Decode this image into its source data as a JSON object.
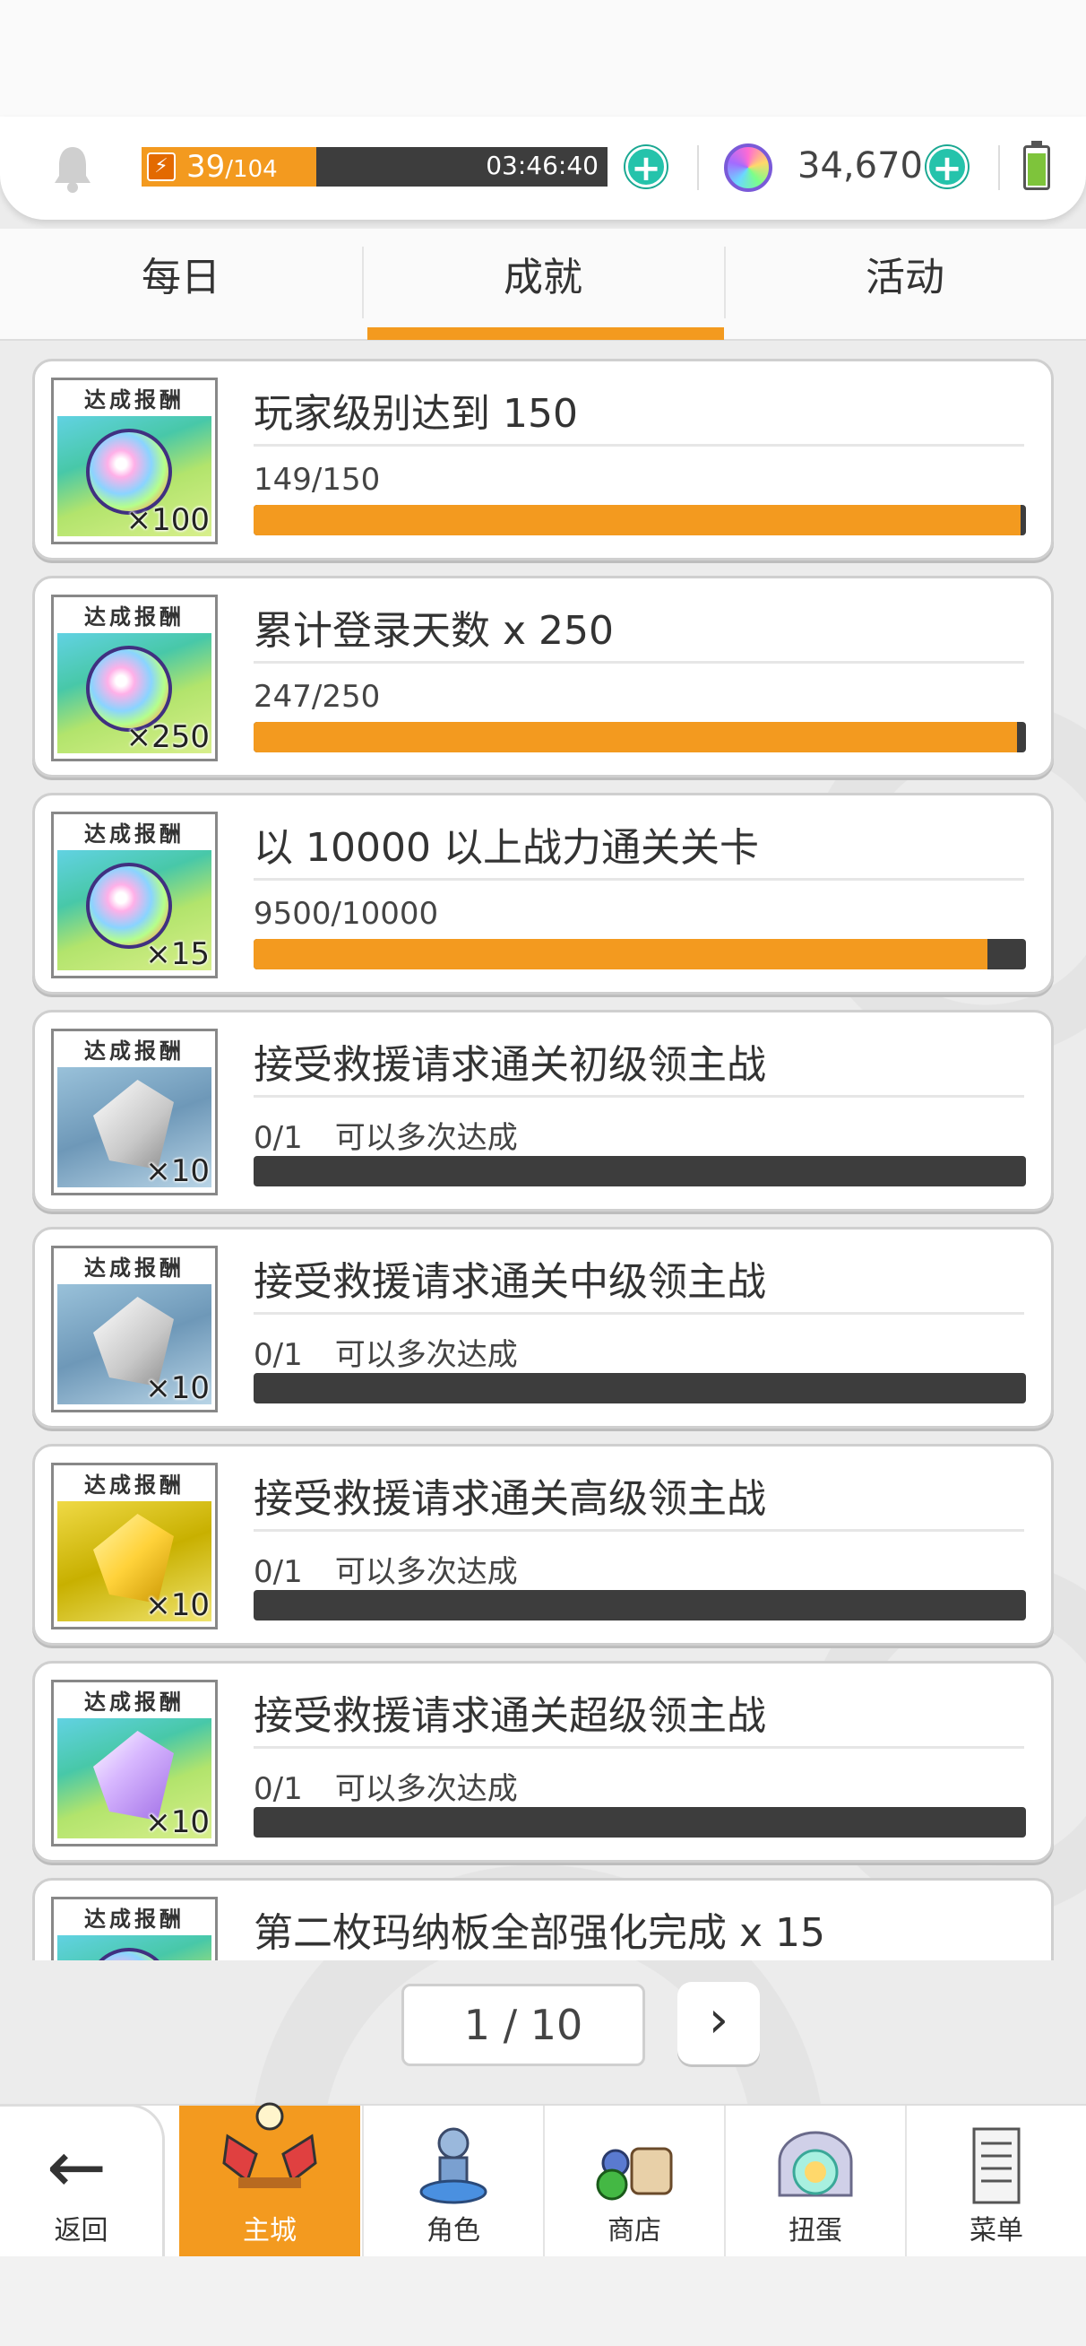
{
  "status": {
    "stamina_current": "39",
    "stamina_max": "/104",
    "stamina_fraction": 0.375,
    "stamina_timer": "03:46:40",
    "gems": "34,670"
  },
  "tabs": [
    {
      "label": "每日",
      "active": false
    },
    {
      "label": "成就",
      "active": true
    },
    {
      "label": "活动",
      "active": false
    }
  ],
  "reward_banner": "达成报酬",
  "achievements": [
    {
      "reward_type": "rainbow-orb",
      "qty": "×100",
      "title": "玩家级别达到 150",
      "progress": "149/150",
      "note": "",
      "fraction": 0.993
    },
    {
      "reward_type": "rainbow-orb",
      "qty": "×250",
      "title": "累计登录天数  x 250",
      "progress": "247/250",
      "note": "",
      "fraction": 0.988
    },
    {
      "reward_type": "rainbow-orb",
      "qty": "×15",
      "title": "以 10000 以上战力通关关卡",
      "progress": "9500/10000",
      "note": "",
      "fraction": 0.95
    },
    {
      "reward_type": "white-crystal",
      "qty": "×10",
      "title": "接受救援请求通关初级领主战",
      "progress": "0/1",
      "note": "可以多次达成",
      "fraction": 0
    },
    {
      "reward_type": "white-crystal",
      "qty": "×10",
      "title": "接受救援请求通关中级领主战",
      "progress": "0/1",
      "note": "可以多次达成",
      "fraction": 0
    },
    {
      "reward_type": "gold-crystal",
      "qty": "×10",
      "title": "接受救援请求通关高级领主战",
      "progress": "0/1",
      "note": "可以多次达成",
      "fraction": 0
    },
    {
      "reward_type": "purple-crystal",
      "qty": "×10",
      "title": "接受救援请求通关超级领主战",
      "progress": "0/1",
      "note": "可以多次达成",
      "fraction": 0
    },
    {
      "reward_type": "rainbow-orb",
      "qty": "",
      "title": "第二枚玛纳板全部强化完成  x 15",
      "progress": "",
      "note": "",
      "fraction": 0
    }
  ],
  "pager": {
    "label": "1 / 10",
    "next_icon": "chevron-right-icon"
  },
  "nav": {
    "back_label": "返回",
    "items": [
      {
        "label": "主城",
        "icon": "castle-icon",
        "active": true
      },
      {
        "label": "角色",
        "icon": "character-icon",
        "active": false
      },
      {
        "label": "商店",
        "icon": "shop-icon",
        "active": false
      },
      {
        "label": "扭蛋",
        "icon": "gacha-icon",
        "active": false
      },
      {
        "label": "菜单",
        "icon": "menu-icon",
        "active": false
      }
    ]
  },
  "colors": {
    "accent": "#f39a1f",
    "bar_bg": "#3d3d3d",
    "plus": "#25c3ab"
  }
}
